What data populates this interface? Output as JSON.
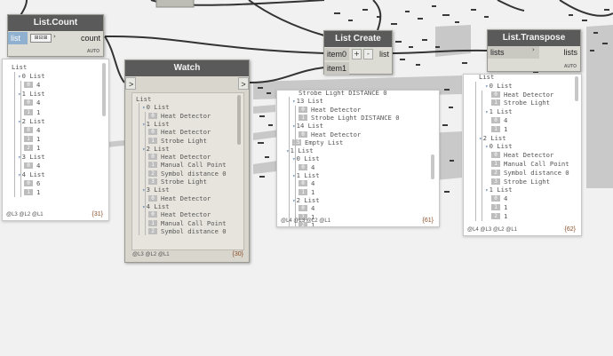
{
  "nodes": {
    "list_count": {
      "title": "List.Count",
      "input": "list",
      "output": "count",
      "lacing": "AUTO"
    },
    "watch": {
      "title": "Watch",
      "input_icon": ">",
      "output_icon": ">"
    },
    "list_create": {
      "title": "List Create",
      "inputs": [
        "item0",
        "item1"
      ],
      "add_label": "+",
      "remove_label": "-",
      "output": "list"
    },
    "list_transpose": {
      "title": "List.Transpose",
      "input": "lists",
      "output": "lists",
      "lacing": "AUTO"
    }
  },
  "previews": {
    "count": {
      "lines": [
        "List",
        "0 List",
        "0",
        "4",
        "1 List",
        "0",
        "4",
        "1",
        "1",
        "2 List",
        "0",
        "4",
        "1",
        "1",
        "2",
        "1",
        "3 List",
        "0",
        "4",
        "4 List",
        "0",
        "6",
        "1",
        "1"
      ],
      "levels": "@L3 @L2 @L1",
      "count": "{31}"
    },
    "watch": {
      "lines": [
        "List",
        "0 List",
        "0",
        "Heat Detector",
        "1 List",
        "0",
        "Heat Detector",
        "1",
        "Strobe Light",
        "2 List",
        "0",
        "Heat Detector",
        "1",
        "Manual Call Point",
        "2",
        "Symbol distance 0",
        "3",
        "Strobe Light",
        "3 List",
        "0",
        "Heat Detector",
        "4 List",
        "0",
        "Heat Detector",
        "1",
        "Manual Call Point",
        "2",
        "Symbol distance 0"
      ],
      "levels": "@L3 @L2 @L1",
      "count": "{30}"
    },
    "list_create": {
      "lines": [
        "Strobe Light DISTANCE 0",
        "13 List",
        "0",
        "Heat Detector",
        "1",
        "Strobe Light DISTANCE 0",
        "14 List",
        "0",
        "Heat Detector",
        "15",
        "Empty List",
        "1 List",
        "0 List",
        "0",
        "4",
        "1 List",
        "0",
        "4",
        "1",
        "1",
        "2 List",
        "0",
        "4",
        "1",
        "1",
        "2",
        "1"
      ],
      "levels": "@L4 @L3 @L2 @L1",
      "count": "{61}"
    },
    "transpose": {
      "lines": [
        "List",
        "0 List",
        "0",
        "Heat Detector",
        "1",
        "Strobe Light",
        "1 List",
        "0",
        "4",
        "1",
        "1",
        "2 List",
        "0 List",
        "0",
        "Heat Detector",
        "1",
        "Manual Call Point",
        "2",
        "Symbol distance 0",
        "3",
        "Strobe Light",
        "1 List",
        "0",
        "4",
        "1",
        "1",
        "2",
        "1"
      ],
      "levels": "@L4 @L3 @L2 @L1",
      "count": "{62}"
    }
  }
}
